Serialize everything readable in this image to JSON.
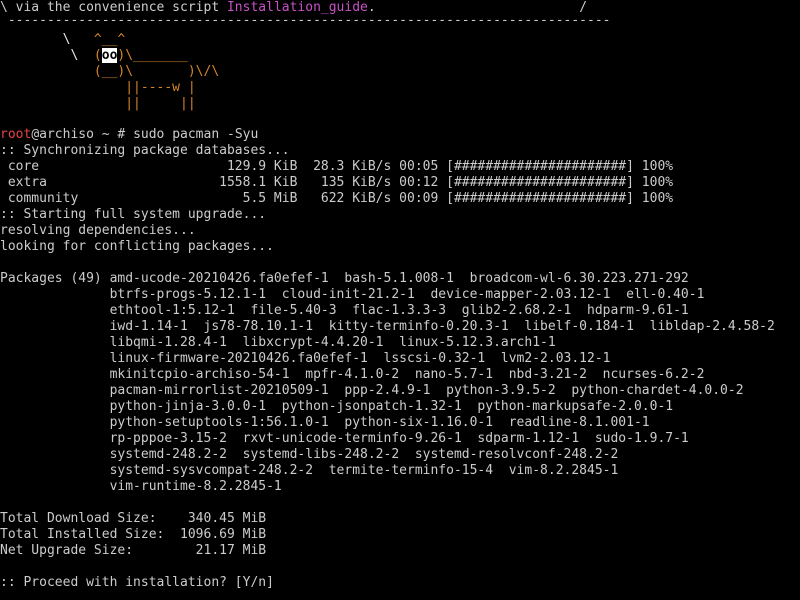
{
  "header": {
    "prefix": "\\ via the convenience script ",
    "link": "Installation_guide",
    "suffix": ".                          /",
    "rule": " -----------------------------------------------------------------------------"
  },
  "cow": {
    "l1_a": "        \\   ",
    "l1_b": "^__^",
    "l2_a": "         \\  ",
    "l2_b": "(",
    "l2_eyes": "oo",
    "l2_c": ")\\_______",
    "l3_a": "            ",
    "l3_b": "(__)\\       )\\/\\",
    "l4": "                ||----w |",
    "l5": "                ||     ||"
  },
  "prompt": {
    "user": "root",
    "host": "@archiso",
    "rest": " ~ # sudo pacman -Syu"
  },
  "sync": {
    "header": ":: Synchronizing package databases...",
    "repos": [
      " core                        129.9 KiB  28.3 KiB/s 00:05 [######################] 100%",
      " extra                      1558.1 KiB   135 KiB/s 00:12 [######################] 100%",
      " community                     5.5 MiB   622 KiB/s 00:09 [######################] 100%"
    ]
  },
  "upgrade": {
    "start": ":: Starting full system upgrade...",
    "resolving": "resolving dependencies...",
    "conflicts": "looking for conflicting packages..."
  },
  "packages": {
    "lines": [
      "Packages (49) amd-ucode-20210426.fa0efef-1  bash-5.1.008-1  broadcom-wl-6.30.223.271-292",
      "              btrfs-progs-5.12.1-1  cloud-init-21.2-1  device-mapper-2.03.12-1  ell-0.40-1",
      "              ethtool-1:5.12-1  file-5.40-3  flac-1.3.3-3  glib2-2.68.2-1  hdparm-9.61-1",
      "              iwd-1.14-1  js78-78.10.1-1  kitty-terminfo-0.20.3-1  libelf-0.184-1  libldap-2.4.58-2",
      "              libqmi-1.28.4-1  libxcrypt-4.4.20-1  linux-5.12.3.arch1-1",
      "              linux-firmware-20210426.fa0efef-1  lsscsi-0.32-1  lvm2-2.03.12-1",
      "              mkinitcpio-archiso-54-1  mpfr-4.1.0-2  nano-5.7-1  nbd-3.21-2  ncurses-6.2-2",
      "              pacman-mirrorlist-20210509-1  ppp-2.4.9-1  python-3.9.5-2  python-chardet-4.0.0-2",
      "              python-jinja-3.0.0-1  python-jsonpatch-1.32-1  python-markupsafe-2.0.0-1",
      "              python-setuptools-1:56.1.0-1  python-six-1.16.0-1  readline-8.1.001-1",
      "              rp-pppoe-3.15-2  rxvt-unicode-terminfo-9.26-1  sdparm-1.12-1  sudo-1.9.7-1",
      "              systemd-248.2-2  systemd-libs-248.2-2  systemd-resolvconf-248.2-2",
      "              systemd-sysvcompat-248.2-2  termite-terminfo-15-4  vim-8.2.2845-1",
      "              vim-runtime-8.2.2845-1"
    ]
  },
  "sizes": {
    "download": "Total Download Size:    340.45 MiB",
    "installed": "Total Installed Size:  1096.69 MiB",
    "net": "Net Upgrade Size:        21.17 MiB"
  },
  "question": ":: Proceed with installation? [Y/n]"
}
